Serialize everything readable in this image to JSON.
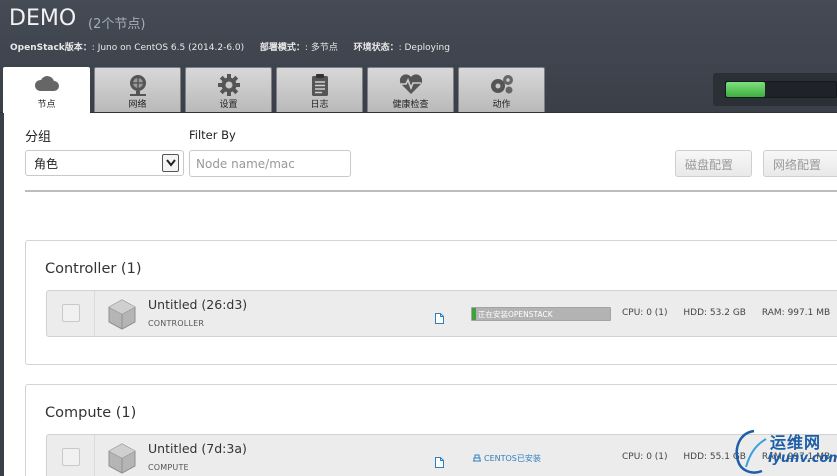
{
  "header": {
    "env_title": "DEMO",
    "env_node_count": "(2个节点)",
    "openstack_label": "OpenStack版本：",
    "openstack_value": ": Juno on CentOS 6.5 (2014.2-6.0)",
    "deploy_mode_label": "部署模式：",
    "deploy_mode_value": ": 多节点",
    "env_status_label": "环境状态：",
    "env_status_value": ": Deploying",
    "deployment_progress": 0.35
  },
  "tabs": [
    {
      "label": "节点",
      "icon": "cloud-icon",
      "active": true
    },
    {
      "label": "网络",
      "icon": "globe-network-icon",
      "active": false
    },
    {
      "label": "设置",
      "icon": "gear-icon",
      "active": false
    },
    {
      "label": "日志",
      "icon": "clipboard-icon",
      "active": false
    },
    {
      "label": "健康检查",
      "icon": "heart-pulse-icon",
      "active": false
    },
    {
      "label": "动作",
      "icon": "cogs-icon",
      "active": false
    }
  ],
  "toolbar": {
    "group_label": "分组",
    "group_selected": "角色",
    "filter_label": "Filter By",
    "filter_placeholder": "Node name/mac",
    "disk_config_label": "磁盘配置",
    "network_config_label": "网络配置"
  },
  "groups": [
    {
      "title": "Controller (1)",
      "nodes": [
        {
          "name": "Untitled (26:d3)",
          "role": "CONTROLLER",
          "status": "正在安装OPENSTACK",
          "status_progress": 0.03,
          "cpu": "CPU: 0 (1)",
          "hdd": "HDD: 53.2 GB",
          "ram": "RAM: 997.1 MB"
        }
      ]
    },
    {
      "title": "Compute (1)",
      "nodes": [
        {
          "name": "Untitled (7d:3a)",
          "role": "COMPUTE",
          "status": "CENTOS已安装",
          "cpu": "CPU: 0 (1)",
          "hdd": "HDD: 55.1 GB",
          "ram": "RAM: 997.1 MB"
        }
      ]
    }
  ],
  "watermark": {
    "cn": "运维网",
    "en": "iyunv.com"
  },
  "colors": {
    "header_bg": "#3f444d",
    "progress_green": "#5fc85f",
    "status_green": "#3da23d",
    "link_blue": "#2f7fbf",
    "watermark_blue": "#1c5ea8"
  }
}
